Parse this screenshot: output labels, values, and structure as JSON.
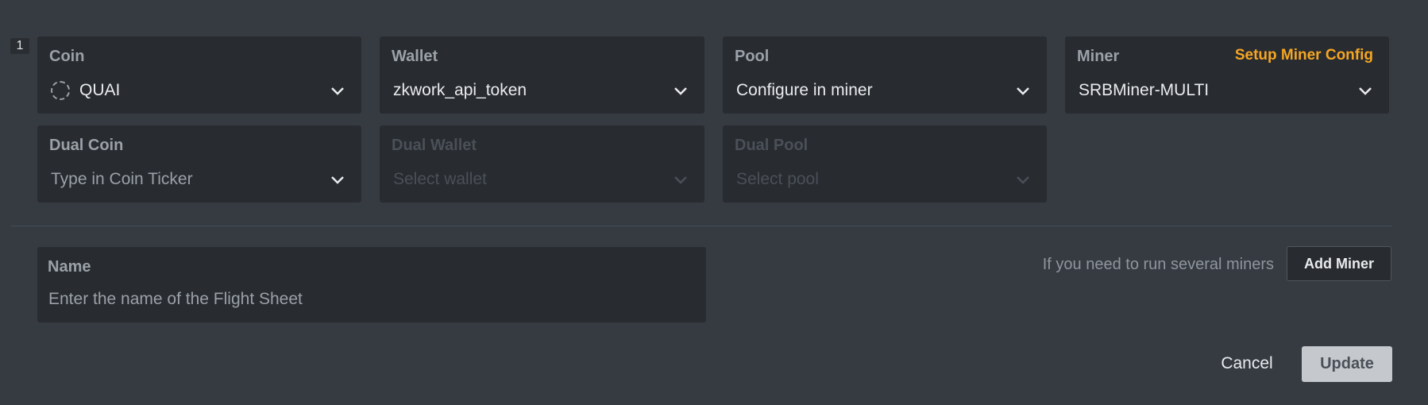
{
  "row_index": "1",
  "coin": {
    "label": "Coin",
    "value": "QUAI",
    "icon": "coin-placeholder-icon"
  },
  "wallet": {
    "label": "Wallet",
    "value": "zkwork_api_token"
  },
  "pool": {
    "label": "Pool",
    "value": "Configure in miner"
  },
  "miner": {
    "label": "Miner",
    "value": "SRBMiner-MULTI",
    "setup_link": "Setup Miner Config"
  },
  "dual_coin": {
    "label": "Dual Coin",
    "placeholder": "Type in Coin Ticker"
  },
  "dual_wallet": {
    "label": "Dual Wallet",
    "placeholder": "Select wallet"
  },
  "dual_pool": {
    "label": "Dual Pool",
    "placeholder": "Select pool"
  },
  "name_field": {
    "label": "Name",
    "placeholder": "Enter the name of the Flight Sheet"
  },
  "hint": "If you need to run several miners",
  "buttons": {
    "add_miner": "Add Miner",
    "cancel": "Cancel",
    "update": "Update"
  },
  "colors": {
    "accent": "#f5a623",
    "background": "#363b42",
    "field_bg": "#282b30"
  }
}
